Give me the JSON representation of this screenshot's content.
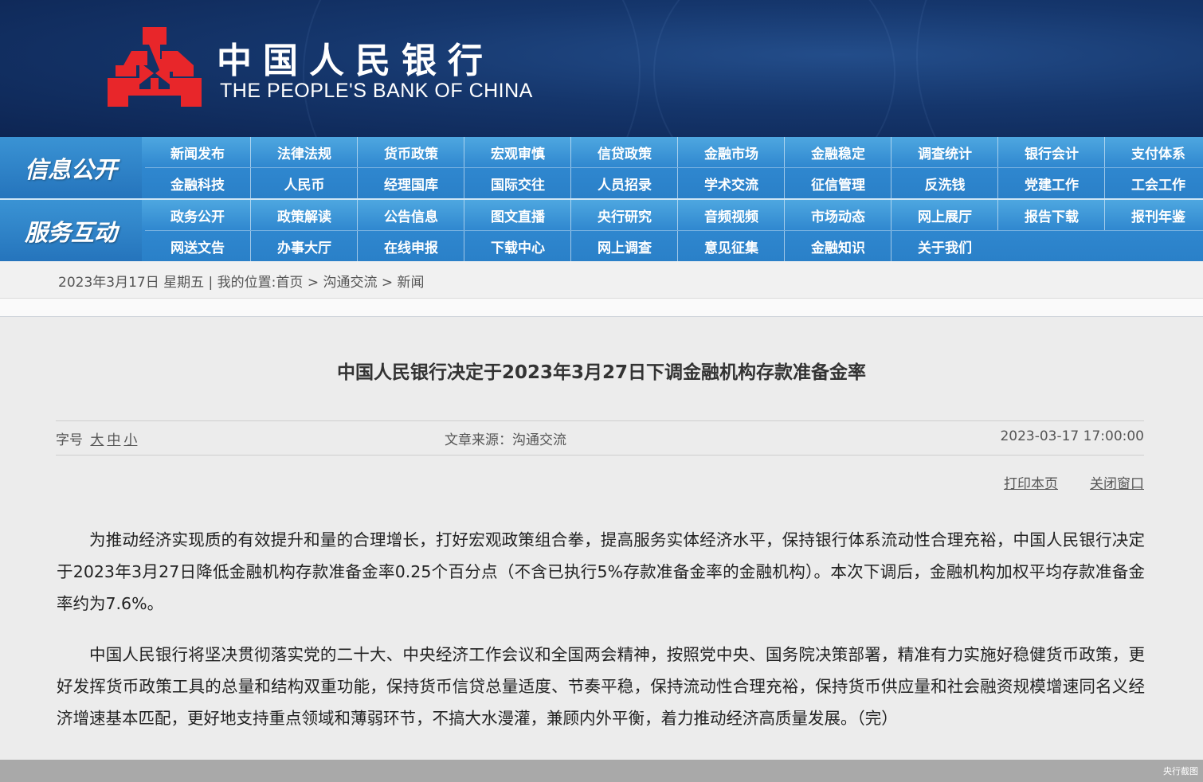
{
  "header": {
    "bank_name_cn": "中国人民银行",
    "bank_name_en": "THE PEOPLE'S BANK OF CHINA",
    "logo_icon": "pboc-logo-icon",
    "brand_red": "#e8262a",
    "banner_color": "#15366c"
  },
  "nav": {
    "groups": [
      {
        "title": "信息公开",
        "rows": [
          [
            "新闻发布",
            "法律法规",
            "货币政策",
            "宏观审慎",
            "信贷政策",
            "金融市场",
            "金融稳定",
            "调查统计",
            "银行会计",
            "支付体系"
          ],
          [
            "金融科技",
            "人民币",
            "经理国库",
            "国际交往",
            "人员招录",
            "学术交流",
            "征信管理",
            "反洗钱",
            "党建工作",
            "工会工作"
          ]
        ]
      },
      {
        "title": "服务互动",
        "rows": [
          [
            "政务公开",
            "政策解读",
            "公告信息",
            "图文直播",
            "央行研究",
            "音频视频",
            "市场动态",
            "网上展厅",
            "报告下载",
            "报刊年鉴"
          ],
          [
            "网送文告",
            "办事大厅",
            "在线申报",
            "下载中心",
            "网上调查",
            "意见征集",
            "金融知识",
            "关于我们"
          ]
        ]
      }
    ],
    "accent": "#2f87cf"
  },
  "breadcrumb": {
    "date": "2023年3月17日 星期五",
    "divider": "|",
    "label": "我的位置:",
    "home": "首页",
    "sep": ">",
    "section": "沟通交流",
    "current": "新闻"
  },
  "article": {
    "title": "中国人民银行决定于2023年3月27日下调金融机构存款准备金率",
    "font_size_label": "字号",
    "font_large": "大",
    "font_medium": "中",
    "font_small": "小",
    "source": "文章来源：沟通交流",
    "datetime": "2023-03-17 17:00:00",
    "print_label": "打印本页",
    "close_label": "关闭窗口",
    "paragraphs": [
      "为推动经济实现质的有效提升和量的合理增长，打好宏观政策组合拳，提高服务实体经济水平，保持银行体系流动性合理充裕，中国人民银行决定于2023年3月27日降低金融机构存款准备金率0.25个百分点（不含已执行5%存款准备金率的金融机构）。本次下调后，金融机构加权平均存款准备金率约为7.6%。",
      "中国人民银行将坚决贯彻落实党的二十大、中央经济工作会议和全国两会精神，按照党中央、国务院决策部署，精准有力实施好稳健货币政策，更好发挥货币政策工具的总量和结构双重功能，保持货币信贷总量适度、节奏平稳，保持流动性合理充裕，保持货币供应量和社会融资规模增速同名义经济增速基本匹配，更好地支持重点领域和薄弱环节，不搞大水漫灌，兼顾内外平衡，着力推动经济高质量发展。（完）"
    ]
  },
  "footer": {
    "watermark": "央行截图"
  }
}
